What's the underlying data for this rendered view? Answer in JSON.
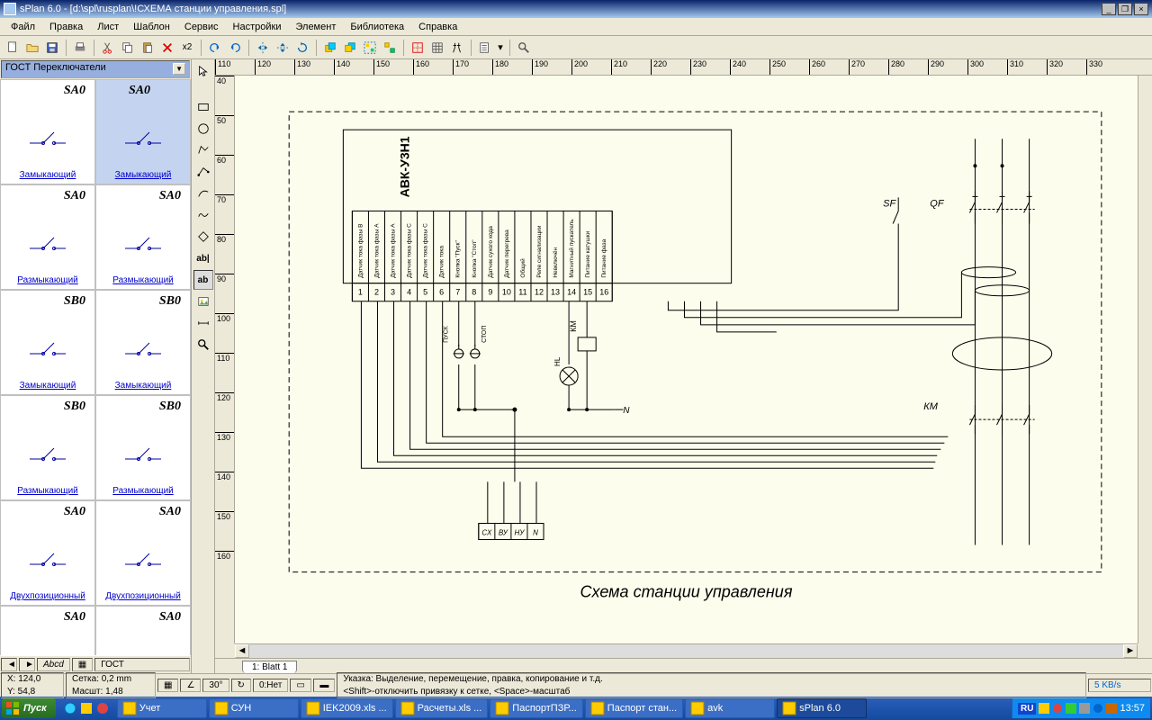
{
  "window": {
    "title": "sPlan 6.0 - [d:\\spl\\rusplan\\!СХЕМА станции управления.spl]"
  },
  "menu": [
    "Файл",
    "Правка",
    "Лист",
    "Шаблон",
    "Сервис",
    "Настройки",
    "Элемент",
    "Библиотека",
    "Справка"
  ],
  "library": {
    "selected": "ГОСТ Переключатели",
    "cells": [
      {
        "ref": "SA0",
        "name": "Замыкающий",
        "sel": false
      },
      {
        "ref": "SA0",
        "name": "Замыкающий",
        "sel": true
      },
      {
        "ref": "SA0",
        "name": "Размыкающий",
        "sel": false
      },
      {
        "ref": "SA0",
        "name": "Размыкающий",
        "sel": false
      },
      {
        "ref": "SB0",
        "name": "Замыкающий",
        "sel": false
      },
      {
        "ref": "SB0",
        "name": "Замыкающий",
        "sel": false
      },
      {
        "ref": "SB0",
        "name": "Размыкающий",
        "sel": false
      },
      {
        "ref": "SB0",
        "name": "Размыкающий",
        "sel": false
      },
      {
        "ref": "SA0",
        "name": "Двухпозиционный",
        "sel": false
      },
      {
        "ref": "SA0",
        "name": "Двухпозиционный",
        "sel": false
      },
      {
        "ref": "SA0",
        "name": "",
        "sel": false
      },
      {
        "ref": "SA0",
        "name": "",
        "sel": false
      }
    ]
  },
  "ruler_h": [
    110,
    120,
    130,
    140,
    150,
    160,
    170,
    180,
    190,
    200,
    210,
    220,
    230,
    240,
    250,
    260,
    270,
    280,
    290,
    300,
    310,
    320,
    330
  ],
  "ruler_v": [
    40,
    50,
    60,
    70,
    80,
    90,
    100,
    110,
    120,
    130,
    140,
    150,
    160
  ],
  "schematic": {
    "title": "АВК-У3Н1",
    "caption": "Схема станции управления",
    "terminals": [
      "1",
      "2",
      "3",
      "4",
      "5",
      "6",
      "7",
      "8",
      "9",
      "10",
      "11",
      "12",
      "13",
      "14",
      "15",
      "16"
    ],
    "termlabels": [
      "Датчик тока фазы В",
      "Датчик тока фазы А",
      "Датчик тока фазы А",
      "Датчик тока фазы С",
      "Датчик тока фазы С",
      "Датчик тока",
      "Кнопка \"Пуск\"",
      "Кнопка \"Стоп\"",
      "Датчик сухого хода",
      "Датчик перегрева",
      "Общий",
      "Реле сигнализации",
      "Невключён",
      "Магнитный пускатель",
      "Питание катушки",
      "Питание фаза"
    ],
    "bottomterms": [
      "СХ",
      "ВУ",
      "НУ",
      "N"
    ],
    "pusk": "ПУСК",
    "stop": "СТОП",
    "km": "КМ",
    "hl": "HL",
    "n": "N",
    "sf": "SF",
    "qf": "QF",
    "km2": "КМ"
  },
  "tabs": [
    "1: Blatt 1"
  ],
  "toolbar2": {
    "x2": "x2"
  },
  "lib_status": {
    "abcd": "Abcd",
    "gost": "ГОСТ"
  },
  "status": {
    "x": "X: 124,0",
    "y": "Y: 54,8",
    "grid_label": "Сетка:",
    "grid": "0,2 mm",
    "scale_label": "Масшт:",
    "scale": "1,48",
    "angle": "30°",
    "nil": "0:Нет",
    "hint": "Указка: Выделение, перемещение, правка, копирование и т.д.",
    "hint2": "<Shift>-отключить привязку к сетке, <Space>-масштаб",
    "speed": "5 KB/s"
  },
  "taskbar": {
    "start": "Пуск",
    "tasks": [
      {
        "label": "Учет",
        "active": false
      },
      {
        "label": "СУН",
        "active": false
      },
      {
        "label": "IEK2009.xls ...",
        "active": false
      },
      {
        "label": "Расчеты.xls ...",
        "active": false
      },
      {
        "label": "ПаспортПЗР...",
        "active": false
      },
      {
        "label": "Паспорт стан...",
        "active": false
      },
      {
        "label": "avk",
        "active": false
      },
      {
        "label": "sPlan 6.0",
        "active": true
      }
    ],
    "lang": "RU",
    "time": "13:57"
  }
}
